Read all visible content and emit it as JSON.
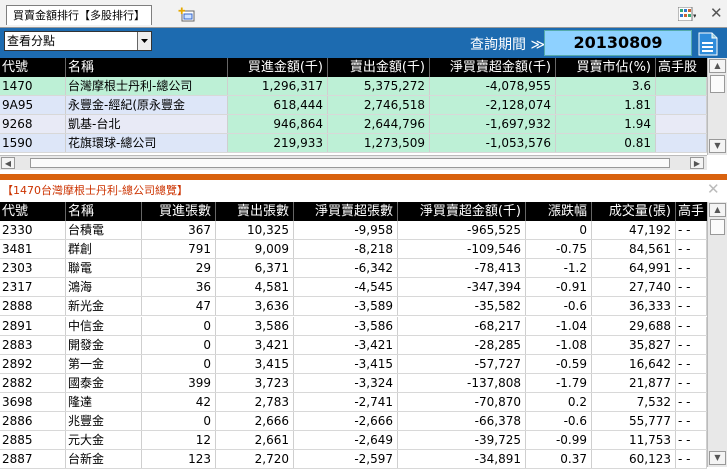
{
  "tab": {
    "label": "買賣金額排行【多股排行】"
  },
  "toolbar": {
    "view_select": "查看分點",
    "query_label": "查詢期間 ≫",
    "query_date": "20130809"
  },
  "broker_table": {
    "columns": [
      "代號",
      "名稱",
      "買進金額(千)",
      "賣出金額(千)",
      "淨買賣超金額(千)",
      "買賣市佔(%)",
      "高手股"
    ],
    "rows": [
      [
        "1470",
        "台灣摩根士丹利-總公司",
        "1,296,317",
        "5,375,272",
        "-4,078,955",
        "3.6"
      ],
      [
        "9A95",
        "永豐金-經紀(原永豐金",
        "618,444",
        "2,746,518",
        "-2,128,074",
        "1.81"
      ],
      [
        "9268",
        "凱基-台北",
        "946,864",
        "2,644,796",
        "-1,697,932",
        "1.94"
      ],
      [
        "1590",
        "花旗環球-總公司",
        "219,933",
        "1,273,509",
        "-1,053,576",
        "0.81"
      ]
    ]
  },
  "detail": {
    "title": "【1470台灣摩根士丹利-總公司總覽】",
    "columns": [
      "代號",
      "名稱",
      "買進張數",
      "賣出張數",
      "淨買賣超張數",
      "淨買賣超金額(千)",
      "漲跌幅",
      "成交量(張)",
      "高手"
    ],
    "rows": [
      [
        "2330",
        "台積電",
        "367",
        "10,325",
        "-9,958",
        "-965,525",
        "0",
        "47,192",
        "- -"
      ],
      [
        "3481",
        "群創",
        "791",
        "9,009",
        "-8,218",
        "-109,546",
        "-0.75",
        "84,561",
        "- -"
      ],
      [
        "2303",
        "聯電",
        "29",
        "6,371",
        "-6,342",
        "-78,413",
        "-1.2",
        "64,991",
        "- -"
      ],
      [
        "2317",
        "鴻海",
        "36",
        "4,581",
        "-4,545",
        "-347,394",
        "-0.91",
        "27,740",
        "- -"
      ],
      [
        "2888",
        "新光金",
        "47",
        "3,636",
        "-3,589",
        "-35,582",
        "-0.6",
        "36,333",
        "- -"
      ],
      [
        "2891",
        "中信金",
        "0",
        "3,586",
        "-3,586",
        "-68,217",
        "-1.04",
        "29,688",
        "- -"
      ],
      [
        "2883",
        "開發金",
        "0",
        "3,421",
        "-3,421",
        "-28,285",
        "-1.08",
        "35,827",
        "- -"
      ],
      [
        "2892",
        "第一金",
        "0",
        "3,415",
        "-3,415",
        "-57,727",
        "-0.59",
        "16,642",
        "- -"
      ],
      [
        "2882",
        "國泰金",
        "399",
        "3,723",
        "-3,324",
        "-137,808",
        "-1.79",
        "21,877",
        "- -"
      ],
      [
        "3698",
        "隆達",
        "42",
        "2,783",
        "-2,741",
        "-70,870",
        "0.2",
        "7,532",
        "- -"
      ],
      [
        "2886",
        "兆豐金",
        "0",
        "2,666",
        "-2,666",
        "-66,378",
        "-0.6",
        "55,777",
        "- -"
      ],
      [
        "2885",
        "元大金",
        "12",
        "2,661",
        "-2,649",
        "-39,725",
        "-0.99",
        "11,753",
        "- -"
      ],
      [
        "2887",
        "台新金",
        "123",
        "2,720",
        "-2,597",
        "-34,891",
        "0.37",
        "60,123",
        "- -"
      ]
    ]
  },
  "colors": {
    "broker_row_bg": "#bdf0d6",
    "broker_row_alt": "#dde6f8",
    "accent": "#1d6bb0",
    "orange": "#d9620e",
    "date_bg": "#8ed1ff"
  }
}
